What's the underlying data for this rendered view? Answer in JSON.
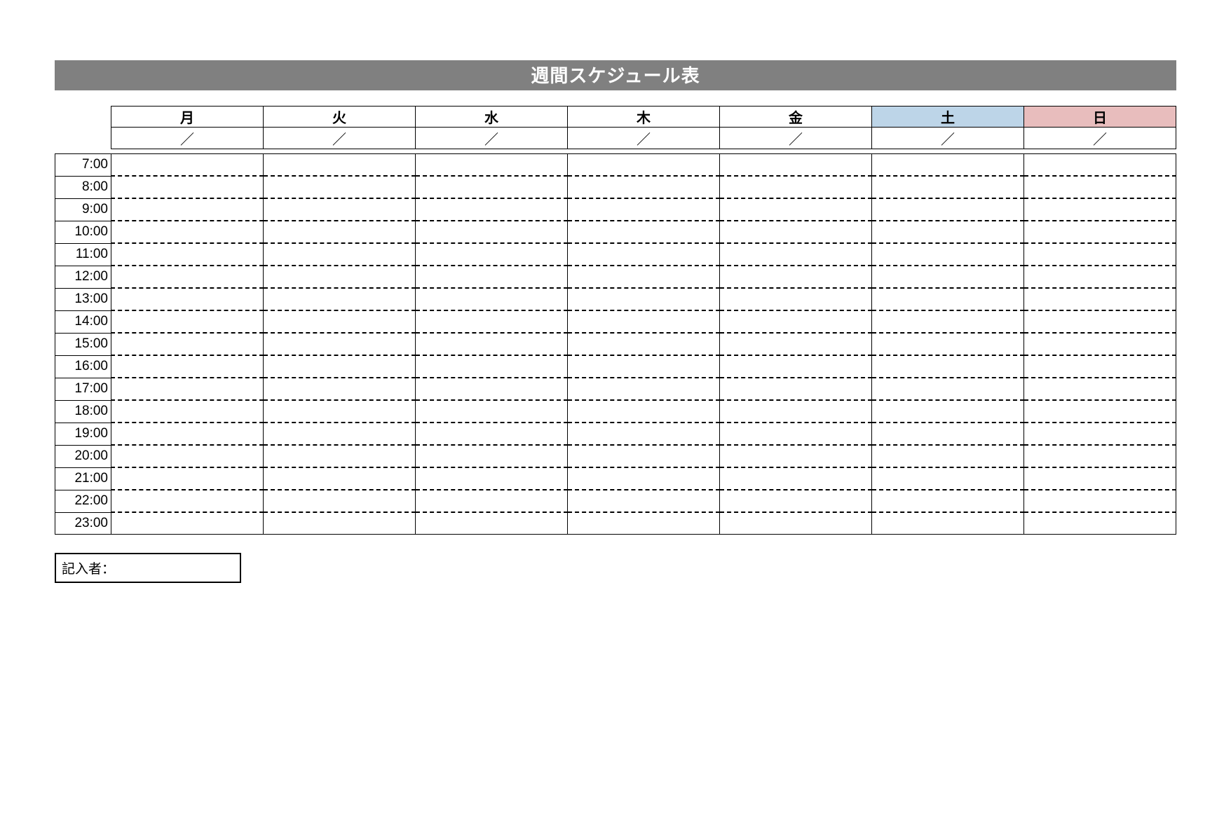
{
  "title": "週間スケジュール表",
  "days": [
    "月",
    "火",
    "水",
    "木",
    "金",
    "土",
    "日"
  ],
  "date_placeholder": "／",
  "times": [
    "7:00",
    "8:00",
    "9:00",
    "10:00",
    "11:00",
    "12:00",
    "13:00",
    "14:00",
    "15:00",
    "16:00",
    "17:00",
    "18:00",
    "19:00",
    "20:00",
    "21:00",
    "22:00",
    "23:00"
  ],
  "cells": [
    [
      "",
      "",
      "",
      "",
      "",
      "",
      ""
    ],
    [
      "",
      "",
      "",
      "",
      "",
      "",
      ""
    ],
    [
      "",
      "",
      "",
      "",
      "",
      "",
      ""
    ],
    [
      "",
      "",
      "",
      "",
      "",
      "",
      ""
    ],
    [
      "",
      "",
      "",
      "",
      "",
      "",
      ""
    ],
    [
      "",
      "",
      "",
      "",
      "",
      "",
      ""
    ],
    [
      "",
      "",
      "",
      "",
      "",
      "",
      ""
    ],
    [
      "",
      "",
      "",
      "",
      "",
      "",
      ""
    ],
    [
      "",
      "",
      "",
      "",
      "",
      "",
      ""
    ],
    [
      "",
      "",
      "",
      "",
      "",
      "",
      ""
    ],
    [
      "",
      "",
      "",
      "",
      "",
      "",
      ""
    ],
    [
      "",
      "",
      "",
      "",
      "",
      "",
      ""
    ],
    [
      "",
      "",
      "",
      "",
      "",
      "",
      ""
    ],
    [
      "",
      "",
      "",
      "",
      "",
      "",
      ""
    ],
    [
      "",
      "",
      "",
      "",
      "",
      "",
      ""
    ],
    [
      "",
      "",
      "",
      "",
      "",
      "",
      ""
    ],
    [
      "",
      "",
      "",
      "",
      "",
      "",
      ""
    ]
  ],
  "author_label": "記入者：",
  "author_value": ""
}
